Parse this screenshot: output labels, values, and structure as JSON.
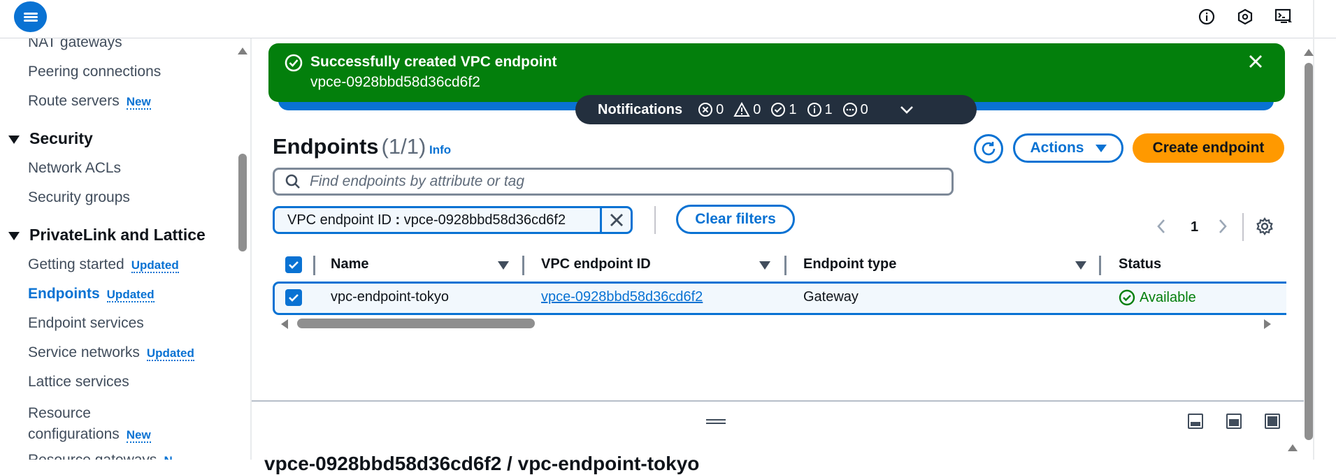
{
  "sidebar": {
    "items": [
      {
        "label": "NAT gateways"
      },
      {
        "label": "Peering connections"
      },
      {
        "label": "Route servers",
        "badge": "New"
      },
      {
        "label": "Network ACLs"
      },
      {
        "label": "Security groups"
      },
      {
        "label": "Getting started",
        "badge": "Updated"
      },
      {
        "label": "Endpoints",
        "badge": "Updated",
        "active": true
      },
      {
        "label": "Endpoint services"
      },
      {
        "label": "Service networks",
        "badge": "Updated"
      },
      {
        "label": "Lattice services"
      },
      {
        "label": "Resource",
        "label2": "configurations",
        "badge": "New"
      },
      {
        "label": "Resource gateways",
        "badge": "N"
      }
    ],
    "sections": {
      "security": "Security",
      "privatelink": "PrivateLink and Lattice"
    }
  },
  "flash": {
    "title": "Successfully created VPC endpoint",
    "subtitle": "vpce-0928bbd58d36cd6f2"
  },
  "notifications": {
    "label": "Notifications",
    "errors": "0",
    "warnings": "0",
    "success": "1",
    "info": "1",
    "in_progress": "0"
  },
  "main": {
    "title": "Endpoints",
    "count": "(1/1)",
    "info": "Info",
    "actions_label": "Actions",
    "create_label": "Create endpoint",
    "search_placeholder": "Find endpoints by attribute or tag",
    "filter_token_key": "VPC endpoint ID",
    "filter_token_value": "vpce-0928bbd58d36cd6f2",
    "clear_filters": "Clear filters",
    "page": "1"
  },
  "table": {
    "headers": [
      "Name",
      "VPC endpoint ID",
      "Endpoint type",
      "Status"
    ],
    "rows": [
      {
        "name": "vpc-endpoint-tokyo",
        "id": "vpce-0928bbd58d36cd6f2",
        "type": "Gateway",
        "status": "Available"
      }
    ]
  },
  "split_panel": {
    "title": "vpce-0928bbd58d36cd6f2 / vpc-endpoint-tokyo"
  },
  "colors": {
    "accent": "#0972d3",
    "success": "#037f0c",
    "primary_button": "#ff9900",
    "notification_bar": "#232f3e"
  }
}
